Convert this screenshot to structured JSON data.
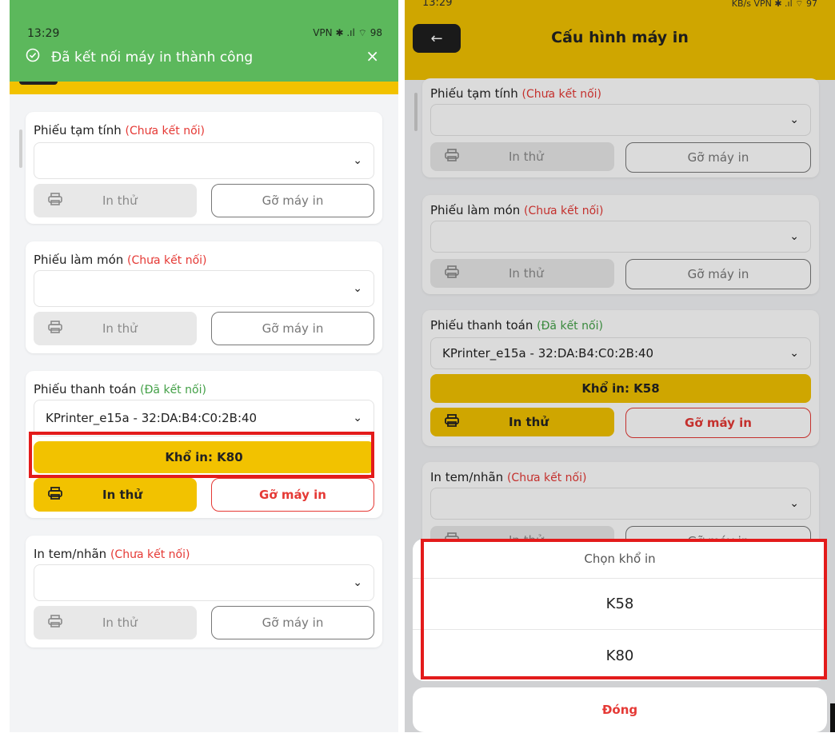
{
  "left": {
    "status_time": "13:29",
    "status_icons": "VPN ✱ .ıl ⌔ 98",
    "toast_message": "Đã kết nối máy in thành công",
    "toast_close": "×",
    "sections": [
      {
        "title": "Phiếu tạm tính",
        "status": "(Chưa kết nối)",
        "selected": "",
        "test_label": "In thử",
        "remove_label": "Gỡ máy in"
      },
      {
        "title": "Phiếu làm món",
        "status": "(Chưa kết nối)",
        "selected": "",
        "test_label": "In thử",
        "remove_label": "Gỡ máy in"
      },
      {
        "title": "Phiếu thanh toán",
        "status": "(Đã kết nối)",
        "selected": "KPrinter_e15a - 32:DA:B4:C0:2B:40",
        "size_label": "Khổ in: K80",
        "test_label": "In thử",
        "remove_label": "Gỡ máy in"
      },
      {
        "title": "In tem/nhãn",
        "status": "(Chưa kết nối)",
        "selected": "",
        "test_label": "In thử",
        "remove_label": "Gỡ máy in"
      }
    ]
  },
  "right": {
    "status_time": "13:29",
    "status_icons": "KB/s VPN ✱ .ıl ⌔ 97",
    "back_label": "←",
    "title": "Cấu hình máy in",
    "sections": [
      {
        "title": "Phiếu tạm tính",
        "status": "(Chưa kết nối)",
        "selected": "",
        "test_label": "In thử",
        "remove_label": "Gỡ máy in"
      },
      {
        "title": "Phiếu làm món",
        "status": "(Chưa kết nối)",
        "selected": "",
        "test_label": "In thử",
        "remove_label": "Gỡ máy in"
      },
      {
        "title": "Phiếu thanh toán",
        "status": "(Đã kết nối)",
        "selected": "KPrinter_e15a - 32:DA:B4:C0:2B:40",
        "size_label": "Khổ in: K58",
        "test_label": "In thử",
        "remove_label": "Gỡ máy in"
      },
      {
        "title": "In tem/nhãn",
        "status": "(Chưa kết nối)",
        "selected": "",
        "test_label": "In thử",
        "remove_label": "Gỡ máy in"
      }
    ],
    "sheet": {
      "title": "Chọn khổ in",
      "options": [
        "K58",
        "K80"
      ],
      "close_label": "Đóng"
    }
  },
  "colors": {
    "accent": "#f2c200",
    "toast": "#5cb85c",
    "danger": "#e53935",
    "connected": "#43a047",
    "highlight": "#e31b1b"
  }
}
